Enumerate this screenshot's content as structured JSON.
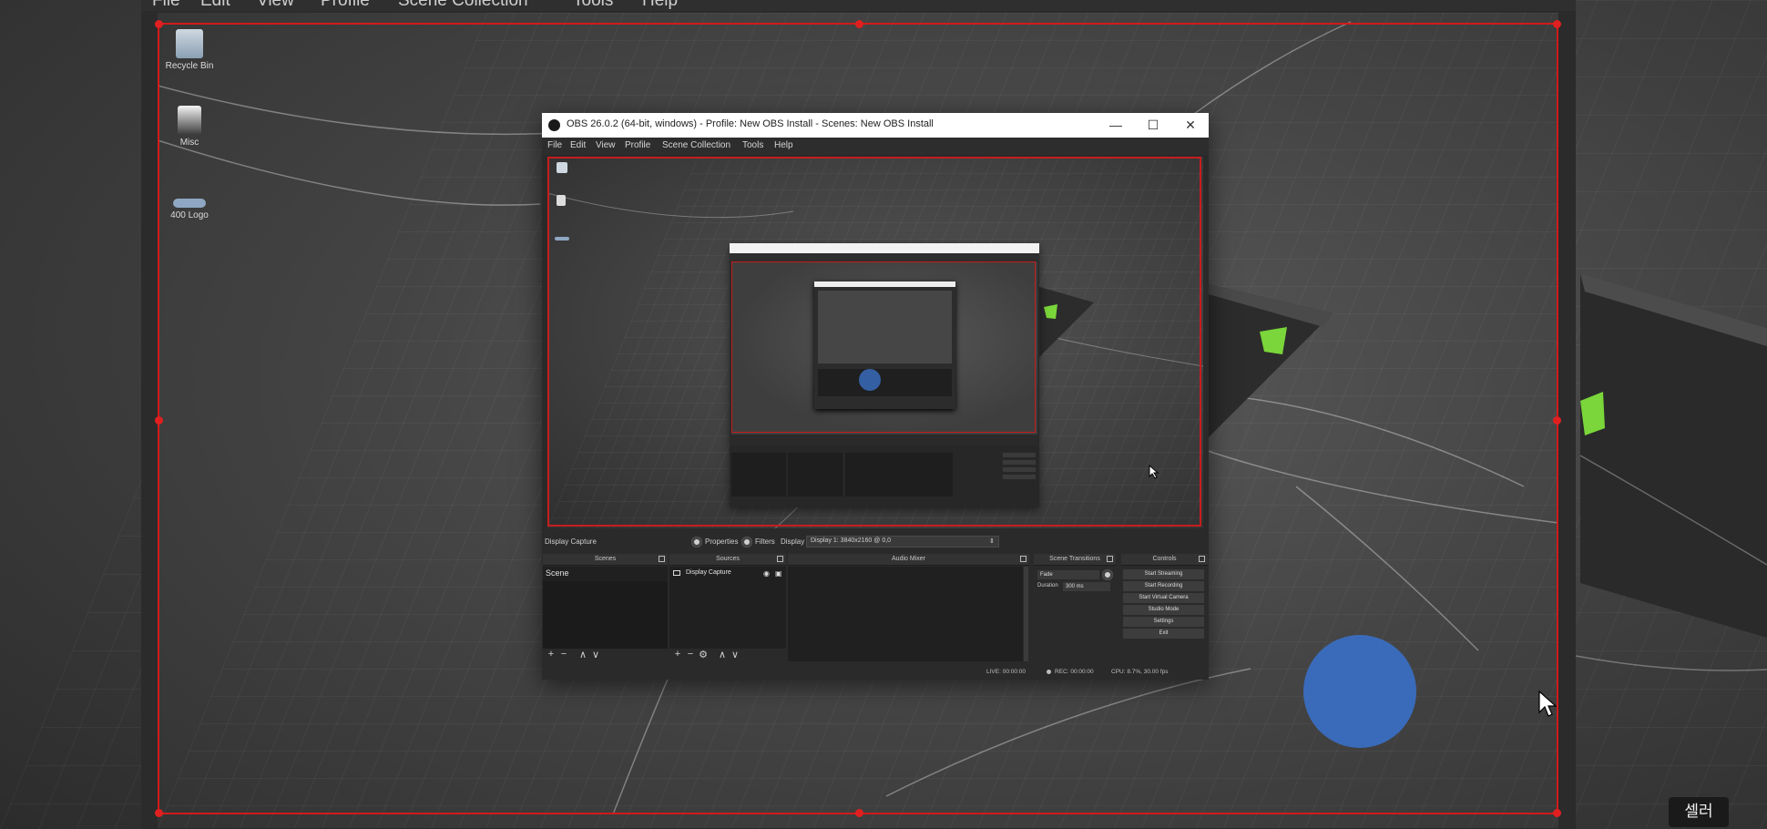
{
  "outer_window": {
    "menu": [
      "File",
      "Edit",
      "View",
      "Profile",
      "Scene Collection",
      "Tools",
      "Help"
    ]
  },
  "desktop_icons": [
    {
      "label": "Recycle Bin",
      "icon": "recycle-bin-icon"
    },
    {
      "label": "Misc",
      "icon": "misc-icon"
    },
    {
      "label": "400 Logo",
      "icon": "logo-file-icon"
    }
  ],
  "obs_window": {
    "title": "OBS 26.0.2 (64-bit, windows) - Profile: New OBS Install - Scenes: New OBS Install",
    "window_controls": {
      "minimize": "—",
      "maximize": "☐",
      "close": "✕"
    },
    "menu": [
      "File",
      "Edit",
      "View",
      "Profile",
      "Scene Collection",
      "Tools",
      "Help"
    ],
    "infobar": {
      "source_name": "Display Capture",
      "properties_label": "Properties",
      "filters_label": "Filters",
      "display_label": "Display",
      "display_value": "Display 1: 3840x2160 @ 0,0"
    },
    "docks": {
      "scenes": {
        "title": "Scenes",
        "items": [
          "Scene"
        ],
        "toolbar": [
          "+",
          "−",
          "∧",
          "∨"
        ]
      },
      "sources": {
        "title": "Sources",
        "items": [
          "Display Capture"
        ],
        "toolbar": [
          "+",
          "−",
          "⚙",
          "∧",
          "∨"
        ]
      },
      "audio_mixer": {
        "title": "Audio Mixer"
      },
      "scene_transitions": {
        "title": "Scene Transitions",
        "transition": "Fade",
        "duration_label": "Duration",
        "duration_value": "300 ms"
      },
      "controls": {
        "title": "Controls",
        "buttons": [
          "Start Streaming",
          "Start Recording",
          "Start Virtual Camera",
          "Studio Mode",
          "Settings",
          "Exit"
        ]
      }
    },
    "statusbar": {
      "live": "LIVE: 00:00:00",
      "rec": "REC: 00:00:00",
      "cpu": "CPU: 8.7%, 30.00 fps"
    }
  },
  "caption_badge": "셀러",
  "colors": {
    "selection_red": "#d21a1a",
    "blue_blob": "#3a6fc4",
    "green_accent": "#7ad63a"
  }
}
